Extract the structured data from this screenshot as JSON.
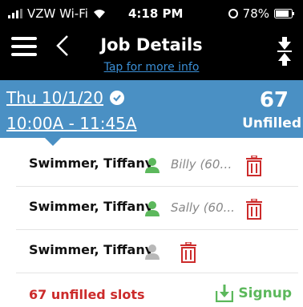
{
  "statusbar": {
    "carrier": "VZW Wi-Fi",
    "time": "4:18 PM",
    "battery": "78%"
  },
  "nav": {
    "title": "Job Details",
    "subtitle": "Tap for more info"
  },
  "shift": {
    "date": "Thu   10/1/20",
    "time": "10:00A - 11:45A",
    "count": "67",
    "count_label": "Unfilled"
  },
  "rows": [
    {
      "name": "Swimmer, Tiffany",
      "assignee": "Billy (608...",
      "assigned": true
    },
    {
      "name": "Swimmer, Tiffany",
      "assignee": "Sally (60...",
      "assigned": true
    },
    {
      "name": "Swimmer, Tiffany",
      "assignee": "",
      "assigned": false
    }
  ],
  "footer": {
    "unfilled_text": "67 unfilled slots",
    "signup_label": "Signup"
  },
  "colors": {
    "blue": "#4a90c4",
    "green": "#5cb85c",
    "red": "#cc2b2b",
    "gray": "#b8b8b8"
  },
  "icons": [
    "signal-icon",
    "wifi-icon",
    "alarm-icon",
    "battery-icon",
    "hamburger-menu-icon",
    "back-chevron-icon",
    "collapse-arrows-icon",
    "checkmark-circle-icon",
    "user-icon",
    "trash-icon",
    "signup-icon"
  ]
}
